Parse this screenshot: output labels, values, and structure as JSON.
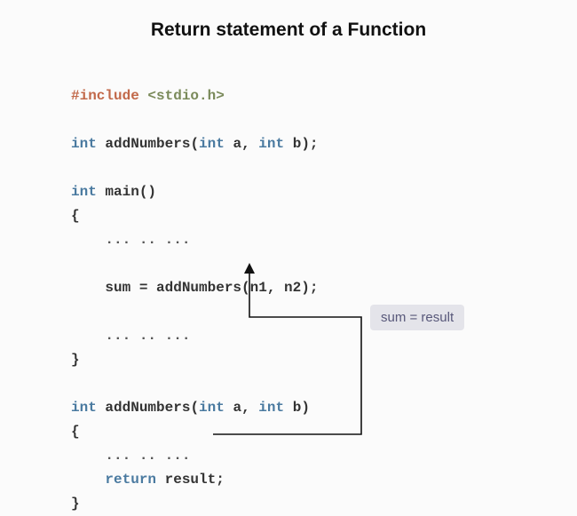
{
  "title": "Return statement of a Function",
  "code": {
    "pp_include": "#include",
    "pp_header": "<stdio.h>",
    "kw_int": "int",
    "id_addNumbers": "addNumbers",
    "proto_params_open": "(",
    "proto_a": "a",
    "sep_comma": ",",
    "proto_b": "b",
    "proto_params_close": ");",
    "id_main": "main",
    "main_params": "()",
    "brace_open": "{",
    "brace_close": "}",
    "ellipsis": "... .. ...",
    "assign_sum": "sum = addNumbers(n1, n2);",
    "def_params_close": ")",
    "kw_return": "return",
    "id_result": "result",
    "stmt_end": ";"
  },
  "annotation": "sum = result"
}
